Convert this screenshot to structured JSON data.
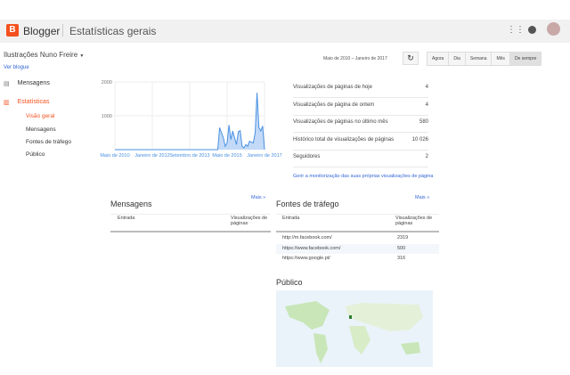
{
  "header": {
    "brand": "Blogger",
    "title": "Estatísticas gerais"
  },
  "blog": {
    "name": "Ilustrações Nuno Freire",
    "view_link": "Ver blogue"
  },
  "range": {
    "label": "Maio de 2010 – Janeiro de 2017",
    "buttons": [
      "Agora",
      "Dia",
      "Semana",
      "Mês",
      "De sempre"
    ],
    "selected": "De sempre"
  },
  "sidebar": {
    "posts": "Mensagens",
    "stats": "Estatísticas",
    "sub": [
      "Visão geral",
      "Mensagens",
      "Fontes de tráfego",
      "Público"
    ]
  },
  "colors": {
    "accent": "#f4511e",
    "line": "#4a90e2",
    "fill": "#b3d1f5"
  },
  "chart_data": {
    "type": "area",
    "x_start": "Maio de 2010",
    "x_end": "Janeiro de 2017",
    "x_step": "month",
    "xticks": [
      "Maio de 2010",
      "Janeiro de 2012",
      "Setembro de 2013",
      "Maio de 2015",
      "Janeiro de 2017"
    ],
    "yticks": [
      1000,
      2000
    ],
    "ylim": [
      0,
      2000
    ],
    "grid": true,
    "values": [
      0,
      0,
      0,
      0,
      0,
      0,
      0,
      0,
      0,
      0,
      0,
      0,
      0,
      0,
      0,
      0,
      0,
      0,
      0,
      0,
      0,
      0,
      0,
      0,
      0,
      0,
      0,
      0,
      0,
      0,
      0,
      0,
      0,
      0,
      0,
      0,
      0,
      0,
      0,
      0,
      0,
      0,
      0,
      0,
      0,
      0,
      0,
      0,
      0,
      0,
      0,
      0,
      0,
      0,
      0,
      0,
      650,
      500,
      350,
      100,
      200,
      730,
      300,
      550,
      350,
      150,
      530,
      560,
      100,
      50,
      150,
      100,
      250,
      220,
      200,
      500,
      1680,
      650,
      550,
      700,
      0
    ]
  },
  "stats": [
    {
      "label": "Visualizações de páginas de hoje",
      "value": "4"
    },
    {
      "label": "Visualizações de página de ontem",
      "value": "4"
    },
    {
      "label": "Visualizações de páginas no último mês",
      "value": "580"
    },
    {
      "label": "Histórico total de visualizações de páginas",
      "value": "10 026"
    },
    {
      "label": "Seguidores",
      "value": "2"
    }
  ],
  "stats_link": "Gerir a monitorização das suas próprias visualizações de página",
  "posts_panel": {
    "title": "Mensagens",
    "more": "Mais »",
    "col1": "Entrada",
    "col2": "Visualizações de páginas"
  },
  "traffic": {
    "title": "Fontes de tráfego",
    "more": "Mais »",
    "col1": "Entrada",
    "col2": "Visualizações de páginas",
    "rows": [
      {
        "url": "http://m.facebook.com/",
        "views": "2319"
      },
      {
        "url": "https://www.facebook.com/",
        "views": "500"
      },
      {
        "url": "https://www.google.pt/",
        "views": "316"
      }
    ]
  },
  "audience": {
    "title": "Público"
  }
}
